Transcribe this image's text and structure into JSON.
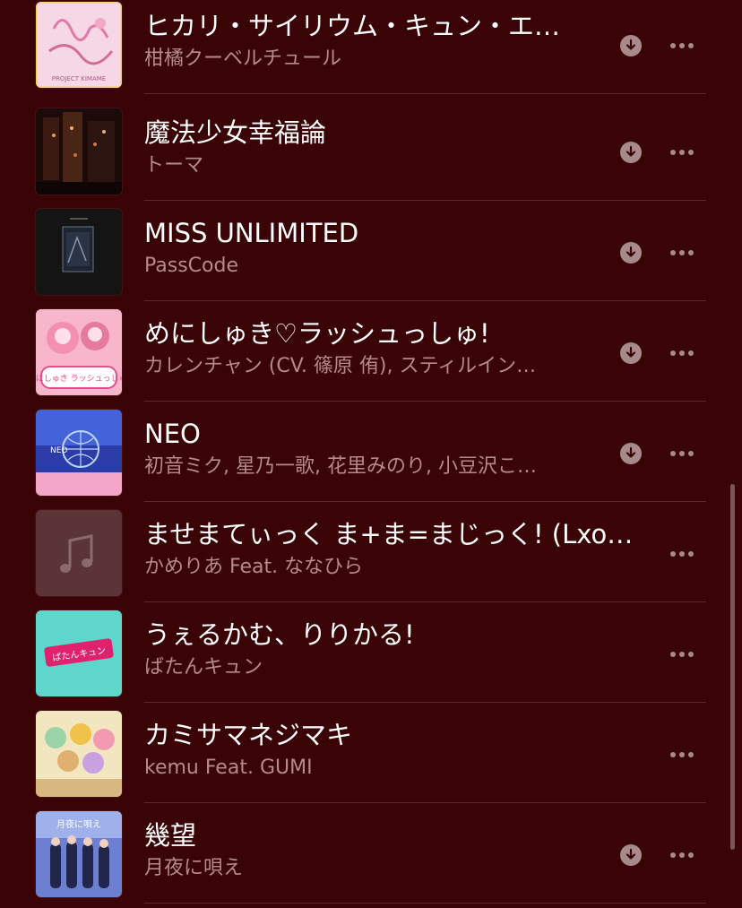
{
  "songs": [
    {
      "title": "ヒカリ・サイリウム・キュン・エ…",
      "artist": "柑橘クーベルチュール",
      "downloadable": true,
      "artwork": "pink-title-art"
    },
    {
      "title": "魔法少女幸福論",
      "artist": "トーマ",
      "downloadable": true,
      "artwork": "dark-city-art"
    },
    {
      "title": "MISS UNLIMITED",
      "artist": "PassCode",
      "downloadable": true,
      "artwork": "dark-frame-art"
    },
    {
      "title": "めにしゅき♡ラッシュっしゅ!",
      "artist": "カレンチャン (CV. 篠原 侑), スティルイン…",
      "downloadable": true,
      "artwork": "pink-anime-art"
    },
    {
      "title": "NEO",
      "artist": "初音ミク, 星乃一歌, 花里みのり, 小豆沢こ…",
      "downloadable": true,
      "artwork": "blue-globe-art"
    },
    {
      "title": "ませまてぃっく ま+ま=まじっく! (Lxo…",
      "artist": "かめりあ Feat. ななひら",
      "downloadable": false,
      "artwork": "placeholder-note-art"
    },
    {
      "title": "うぇるかむ、りりかる!",
      "artist": "ばたんキュン",
      "downloadable": false,
      "artwork": "cyan-logo-art"
    },
    {
      "title": "カミサマネジマキ",
      "artist": "kemu Feat. GUMI",
      "downloadable": false,
      "artwork": "crowd-anime-art"
    },
    {
      "title": "幾望",
      "artist": "月夜に唄え",
      "downloadable": true,
      "artwork": "group-photo-art"
    }
  ],
  "artwork_labels": {
    "row0": "PROJECT KIMAME",
    "row3": "めにしゅき ラッシュっしゅ!",
    "row4": "NEO",
    "row6": "ばたんキュン",
    "row8": "月夜に唄え"
  },
  "colors": {
    "background": "#3a0406",
    "title": "#ffffff",
    "subtitle": "#b58a8b",
    "icon": "#a98a8b"
  }
}
